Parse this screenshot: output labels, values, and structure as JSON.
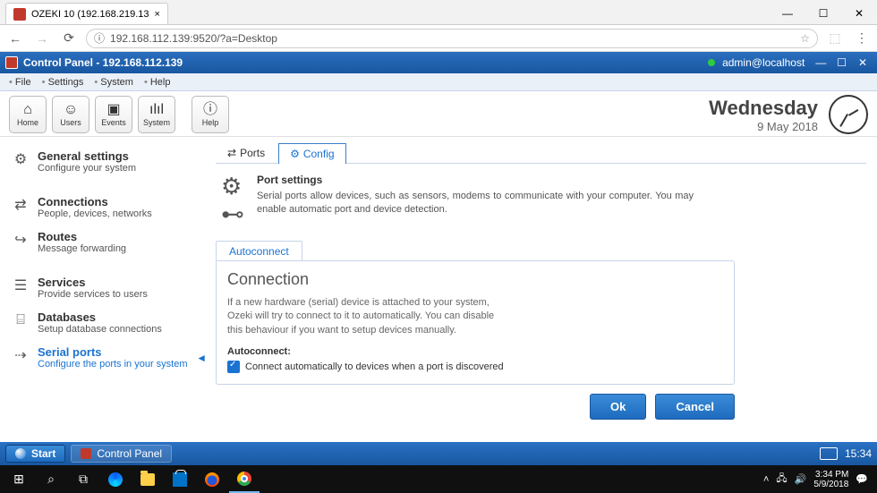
{
  "browser": {
    "tab_title": "OZEKI 10 (192.168.219.13",
    "url": "192.168.112.139:9520/?a=Desktop"
  },
  "app": {
    "title": "Control Panel - 192.168.112.139",
    "user": "admin@localhost"
  },
  "menubar": [
    "File",
    "Settings",
    "System",
    "Help"
  ],
  "toolbar": [
    {
      "icon": "⌂",
      "label": "Home"
    },
    {
      "icon": "☺",
      "label": "Users"
    },
    {
      "icon": "▣",
      "label": "Events"
    },
    {
      "icon": "ılıl",
      "label": "System"
    },
    {
      "icon": "ⓘ",
      "label": "Help"
    }
  ],
  "date": {
    "day": "Wednesday",
    "date": "9 May 2018"
  },
  "sidebar": [
    {
      "icon": "⚙",
      "title": "General settings",
      "sub": "Configure your system"
    },
    {
      "icon": "⇄",
      "title": "Connections",
      "sub": "People, devices, networks"
    },
    {
      "icon": "↪",
      "title": "Routes",
      "sub": "Message forwarding"
    },
    {
      "icon": "☰",
      "title": "Services",
      "sub": "Provide services to users"
    },
    {
      "icon": "⌸",
      "title": "Databases",
      "sub": "Setup database connections"
    },
    {
      "icon": "⇢",
      "title": "Serial ports",
      "sub": "Configure the ports in your system"
    }
  ],
  "tabs": [
    {
      "icon": "⇄",
      "label": "Ports"
    },
    {
      "icon": "⚙",
      "label": "Config"
    }
  ],
  "port_settings": {
    "title": "Port settings",
    "desc": "Serial ports allow devices, such as sensors, modems to communicate with your computer. You may enable automatic port and device detection."
  },
  "subtab": "Autoconnect",
  "connection": {
    "legend": "Connection",
    "desc": "If a new hardware (serial) device is attached to your system, Ozeki will try to connect to it to automatically. You can disable this behaviour if you want to setup devices manually.",
    "label": "Autoconnect:",
    "checkbox": "Connect automatically to devices when a port is discovered"
  },
  "buttons": {
    "ok": "Ok",
    "cancel": "Cancel"
  },
  "app_taskbar": {
    "start": "Start",
    "item": "Control Panel",
    "time": "15:34"
  },
  "win_taskbar": {
    "time": "3:34 PM",
    "date": "5/9/2018"
  }
}
